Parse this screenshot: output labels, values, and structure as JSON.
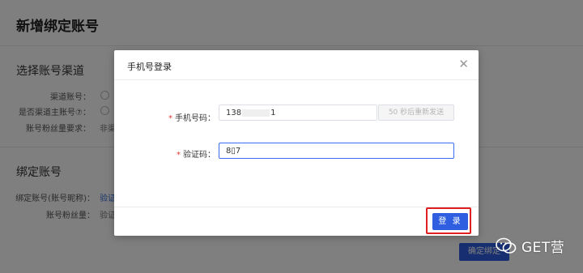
{
  "page": {
    "title": "新增绑定账号",
    "section_channel": "选择账号渠道",
    "section_bind": "绑定账号",
    "fields": {
      "channel_account_label": "渠道账号：",
      "is_main_label": "是否渠道主账号⑦：",
      "fans_req_label": "账号粉丝量要求：",
      "fans_req_value": "非渠",
      "bind_account_label": "绑定账号(账号昵称)：",
      "bind_account_value": "验证",
      "fans_count_label": "账号粉丝量：",
      "fans_count_value": "验证"
    },
    "bind_button": "确定绑定"
  },
  "modal": {
    "title": "手机号登录",
    "close_icon": "close-icon",
    "phone_label": "手机号码：",
    "phone_prefix": "138",
    "phone_suffix": "1",
    "send_code_label": "50 秒后重新发送",
    "code_label": "验证码：",
    "code_value": "8▯7",
    "login_label": "登 录",
    "required_mark": "*"
  },
  "watermark": {
    "text": "GET营",
    "icon": "wechat-icon"
  },
  "colors": {
    "primary": "#2f5fe0",
    "required": "#e53935",
    "highlight_border": "#e02020"
  }
}
